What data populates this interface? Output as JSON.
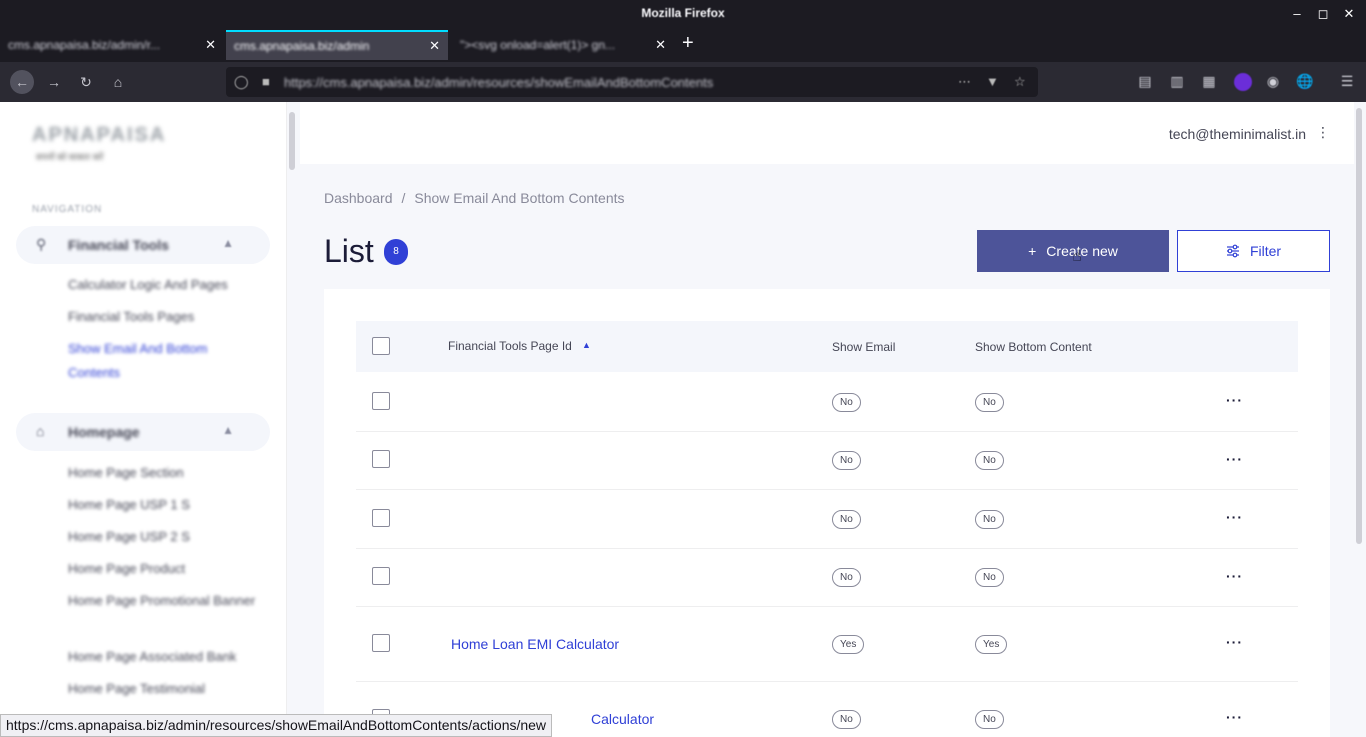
{
  "browser": {
    "window_title": "Mozilla Firefox",
    "tabs": [
      {
        "label": "cms.apnapaisa.biz/admin/r..."
      },
      {
        "label": "cms.apnapaisa.biz/admin",
        "active": true
      },
      {
        "label": "\"><svg onload=alert(1)> gn..."
      }
    ],
    "url": "https://cms.apnapaisa.biz/admin/resources/showEmailAndBottomContents",
    "status_url": "https://cms.apnapaisa.biz/admin/resources/showEmailAndBottomContents/actions/new"
  },
  "sidebar": {
    "logo_text": "APNAPAISA",
    "logo_sub": "सपनों को साकार करें",
    "heading": "NAVIGATION",
    "groups": [
      {
        "label": "Financial Tools",
        "icon": "search-icon",
        "items": [
          "Calculator Logic And Pages",
          "Financial Tools Pages",
          "Show Email And Bottom Contents"
        ]
      },
      {
        "label": "Homepage",
        "icon": "home-icon",
        "items": [
          "Home Page Section",
          "Home Page USP 1 S",
          "Home Page USP 2 S",
          "Home Page Product",
          "Home Page Promotional Banner",
          "Home Page Associated Bank",
          "Home Page Testimonial"
        ]
      }
    ]
  },
  "header": {
    "user_email": "tech@theminimalist.in"
  },
  "breadcrumb": {
    "home": "Dashboard",
    "separator": "/",
    "current": "Show Email And Bottom Contents"
  },
  "page": {
    "title": "List",
    "count": "8",
    "create_label": "Create new",
    "filter_label": "Filter"
  },
  "table": {
    "columns": [
      "Financial Tools Page Id",
      "Show Email",
      "Show Bottom Content"
    ],
    "rows": [
      {
        "page_id": "",
        "show_email": "No",
        "show_bottom": "No"
      },
      {
        "page_id": "",
        "show_email": "No",
        "show_bottom": "No"
      },
      {
        "page_id": "",
        "show_email": "No",
        "show_bottom": "No"
      },
      {
        "page_id": "",
        "show_email": "No",
        "show_bottom": "No"
      },
      {
        "page_id": "Home Loan EMI Calculator",
        "show_email": "Yes",
        "show_bottom": "Yes"
      },
      {
        "page_id": "Calculator",
        "show_email": "No",
        "show_bottom": "No"
      }
    ],
    "row_menu": "···"
  }
}
